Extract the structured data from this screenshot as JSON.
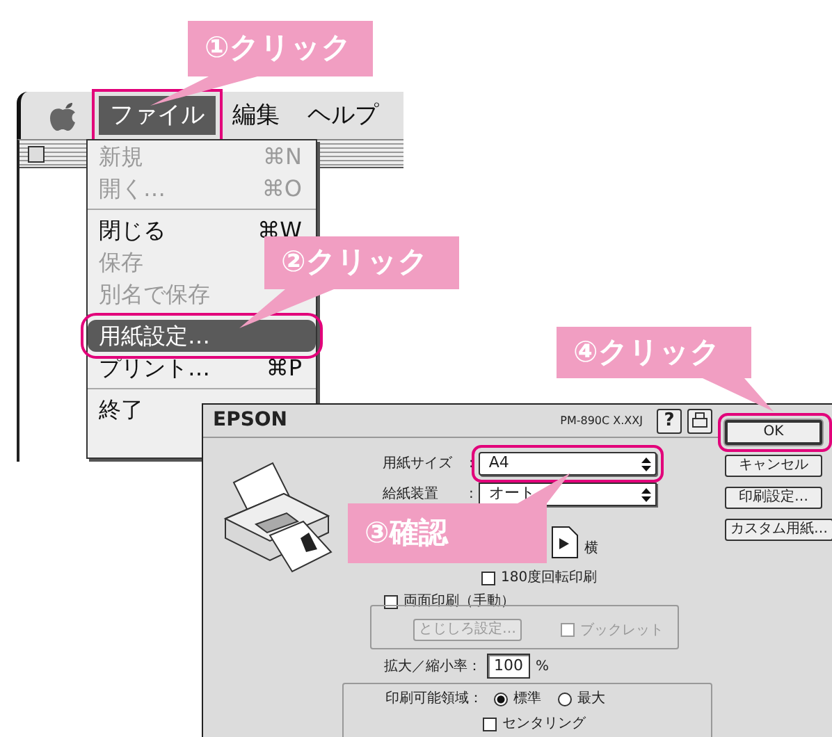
{
  "callouts": [
    {
      "label": "①クリック"
    },
    {
      "label": "②クリック"
    },
    {
      "label": "④クリック"
    },
    {
      "label": "③確認"
    }
  ],
  "menu_bar": {
    "items": [
      {
        "label": "ファイル",
        "selected": true,
        "highlighted": true
      },
      {
        "label": "編集",
        "selected": false,
        "highlighted": false
      },
      {
        "label": "ヘルプ",
        "selected": false,
        "highlighted": false
      }
    ]
  },
  "file_menu": {
    "items": [
      {
        "kind": "item",
        "label": "新規",
        "shortcut": "⌘N",
        "disabled": true,
        "selected": false,
        "highlighted": false
      },
      {
        "kind": "item",
        "label": "開く…",
        "shortcut": "⌘O",
        "disabled": true,
        "selected": false,
        "highlighted": false
      },
      {
        "kind": "separator"
      },
      {
        "kind": "item",
        "label": "閉じる",
        "shortcut": "⌘W",
        "disabled": false,
        "selected": false,
        "highlighted": false
      },
      {
        "kind": "item",
        "label": "保存",
        "disabled": true,
        "selected": false,
        "highlighted": false
      },
      {
        "kind": "item",
        "label": "別名で保存",
        "disabled": true,
        "selected": false,
        "highlighted": false
      },
      {
        "kind": "separator"
      },
      {
        "kind": "item",
        "label": "用紙設定…",
        "disabled": false,
        "selected": true,
        "highlighted": true
      },
      {
        "kind": "item",
        "label": "プリント…",
        "shortcut": "⌘P",
        "disabled": false,
        "selected": false,
        "highlighted": false
      },
      {
        "kind": "separator"
      },
      {
        "kind": "item",
        "label": "終了",
        "disabled": false,
        "selected": false,
        "highlighted": false
      }
    ]
  },
  "dialog": {
    "title": "EPSON",
    "model": "PM-890C X.XXJ",
    "help_button": "?",
    "paper_size": {
      "label": "用紙サイズ",
      "colon": ":",
      "value": "A4",
      "highlighted": true
    },
    "paper_source": {
      "label": "給紙装置",
      "colon": ":",
      "value": "オート"
    },
    "orientation": {
      "label": "横"
    },
    "rotate_180": {
      "label": "180度回転印刷",
      "checked": false
    },
    "duplex": {
      "label": "両面印刷（手動）",
      "checked": false,
      "margin_button": {
        "label": "とじしろ設定…",
        "disabled": true
      },
      "booklet": {
        "label": "ブックレット",
        "checked": false,
        "disabled": true
      }
    },
    "scale": {
      "label": "拡大／縮小率：",
      "value": "100",
      "unit": "%"
    },
    "printable_area": {
      "label": "印刷可能領域：",
      "options": [
        {
          "label": "標準",
          "selected": true
        },
        {
          "label": "最大",
          "selected": false
        }
      ],
      "centering": {
        "label": "センタリング",
        "checked": false
      }
    },
    "buttons": [
      {
        "label": "OK",
        "default": true,
        "highlighted": true
      },
      {
        "label": "キャンセル",
        "default": false,
        "highlighted": false
      },
      {
        "label": "印刷設定…",
        "default": false,
        "highlighted": false
      },
      {
        "label": "カスタム用紙…",
        "default": false,
        "highlighted": false
      }
    ]
  }
}
